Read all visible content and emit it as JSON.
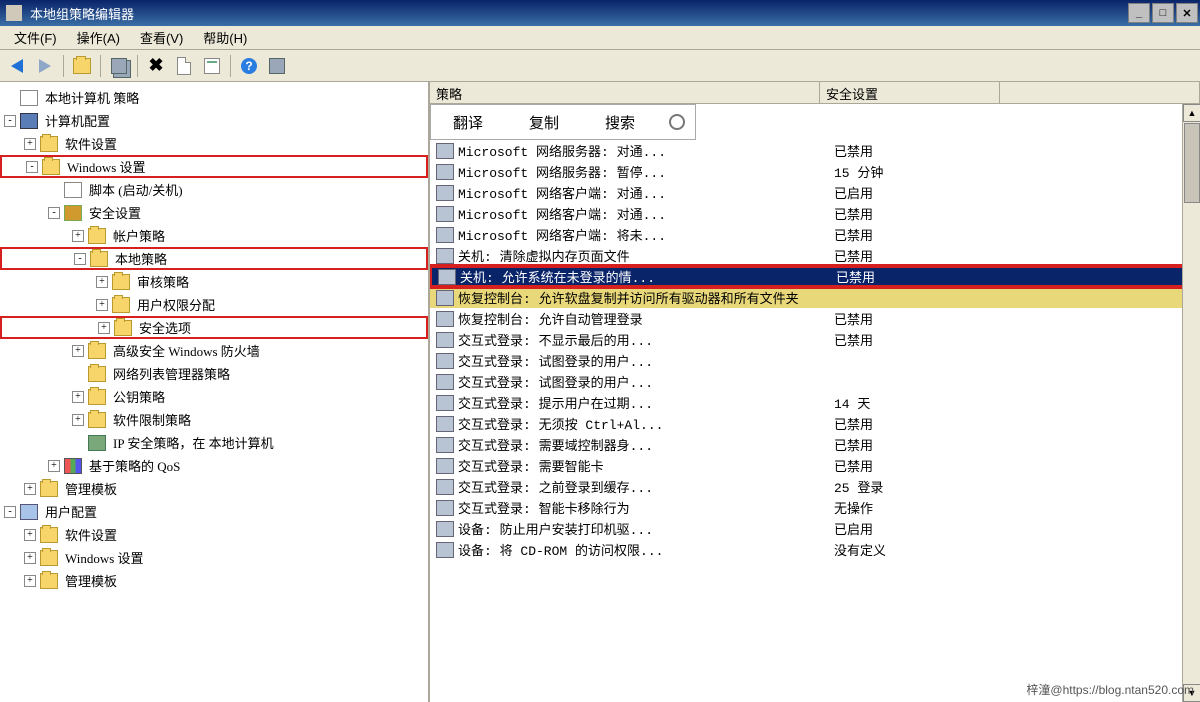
{
  "window": {
    "title": "本地组策略编辑器"
  },
  "menu": {
    "file": "文件(F)",
    "action": "操作(A)",
    "view": "查看(V)",
    "help": "帮助(H)"
  },
  "tree": {
    "root": "本地计算机 策略",
    "compCfg": "计算机配置",
    "softSettings": "软件设置",
    "winSettings": "Windows 设置",
    "scripts": "脚本 (启动/关机)",
    "secSettings": "安全设置",
    "acctPolicy": "帐户策略",
    "localPolicy": "本地策略",
    "auditPolicy": "审核策略",
    "userRights": "用户权限分配",
    "secOptions": "安全选项",
    "advFirewall": "高级安全 Windows 防火墙",
    "netListMgr": "网络列表管理器策略",
    "pubKey": "公钥策略",
    "softRestrict": "软件限制策略",
    "ipSec": "IP 安全策略，在 本地计算机",
    "policyQos": "基于策略的 QoS",
    "adminTmpl": "管理模板",
    "userCfg": "用户配置",
    "softSettings2": "软件设置",
    "winSettings2": "Windows 设置",
    "adminTmpl2": "管理模板"
  },
  "listHeader": {
    "policy": "策略",
    "security": "安全设置"
  },
  "overlay": {
    "translate": "翻译",
    "copy": "复制",
    "search": "搜索"
  },
  "policies": [
    {
      "name": "Microsoft 网络服务器: 对通...",
      "value": "已禁用"
    },
    {
      "name": "Microsoft 网络服务器: 暂停...",
      "value": "15 分钟"
    },
    {
      "name": "Microsoft 网络客户端: 对通...",
      "value": "已启用"
    },
    {
      "name": "Microsoft 网络客户端: 对通...",
      "value": "已禁用"
    },
    {
      "name": "Microsoft 网络客户端: 将未...",
      "value": "已禁用"
    },
    {
      "name": "关机: 清除虚拟内存页面文件",
      "value": "已禁用"
    },
    {
      "name": "关机: 允许系统在未登录的情...",
      "value": "已禁用",
      "selected": true
    },
    {
      "name": "恢复控制台: 允许软盘复制并访问所有驱动器和所有文件夹",
      "value": "",
      "yellow": true
    },
    {
      "name": "恢复控制台: 允许自动管理登录",
      "value": "已禁用"
    },
    {
      "name": "交互式登录: 不显示最后的用...",
      "value": "已禁用"
    },
    {
      "name": "交互式登录: 试图登录的用户...",
      "value": ""
    },
    {
      "name": "交互式登录: 试图登录的用户...",
      "value": ""
    },
    {
      "name": "交互式登录: 提示用户在过期...",
      "value": "14 天"
    },
    {
      "name": "交互式登录: 无须按 Ctrl+Al...",
      "value": "已禁用"
    },
    {
      "name": "交互式登录: 需要域控制器身...",
      "value": "已禁用"
    },
    {
      "name": "交互式登录: 需要智能卡",
      "value": "已禁用"
    },
    {
      "name": "交互式登录: 之前登录到缓存...",
      "value": "25 登录"
    },
    {
      "name": "交互式登录: 智能卡移除行为",
      "value": "无操作"
    },
    {
      "name": "设备: 防止用户安装打印机驱...",
      "value": "已启用"
    },
    {
      "name": "设备: 将 CD-ROM 的访问权限...",
      "value": "没有定义"
    }
  ],
  "watermark": "梓潼@https://blog.ntan520.com"
}
